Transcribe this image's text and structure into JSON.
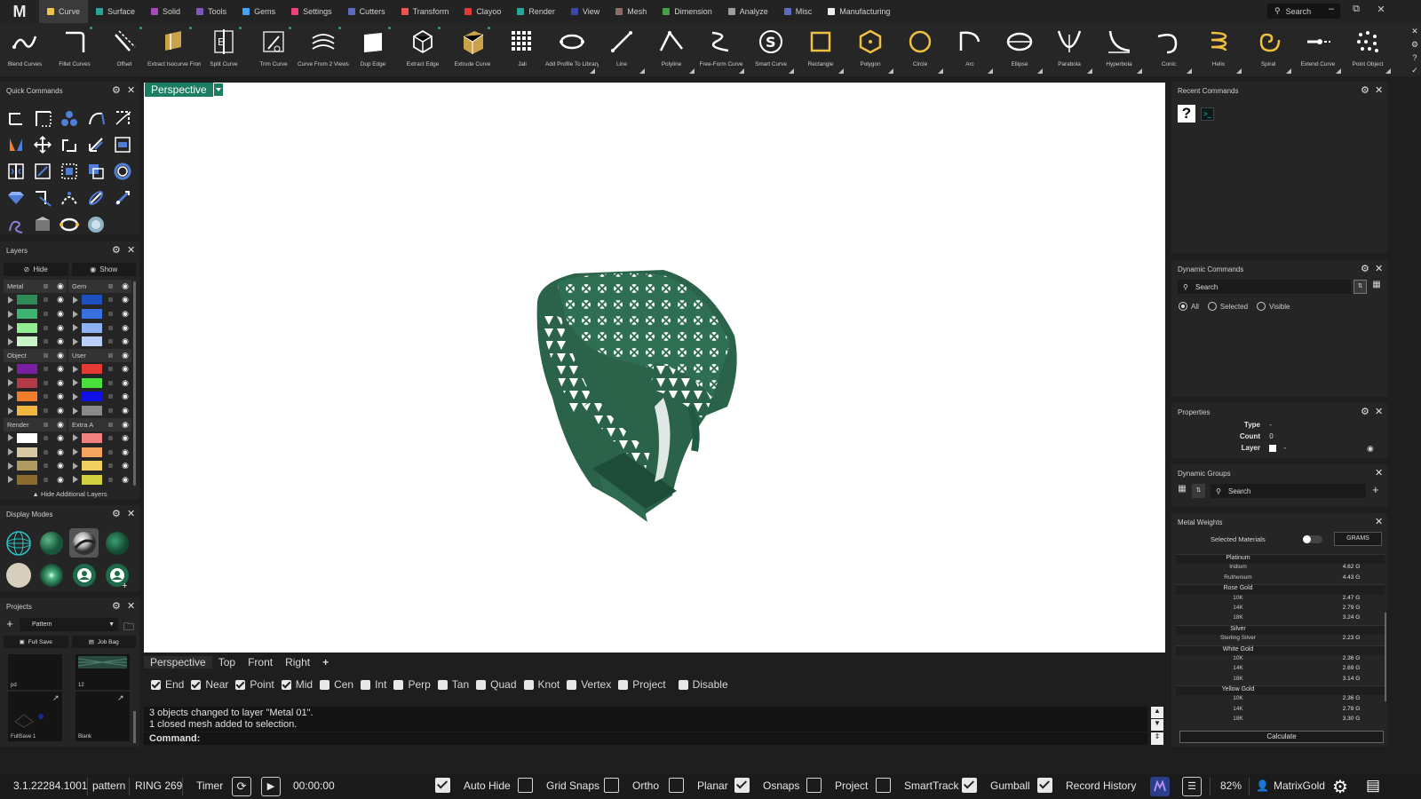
{
  "app": {
    "logo": "M",
    "search_label": "Search"
  },
  "menu": [
    {
      "label": "Curve",
      "color": "#f2c14e",
      "active": true
    },
    {
      "label": "Surface",
      "color": "#26a69a"
    },
    {
      "label": "Solid",
      "color": "#ab47bc"
    },
    {
      "label": "Tools",
      "color": "#7e57c2"
    },
    {
      "label": "Gems",
      "color": "#42a5f5"
    },
    {
      "label": "Settings",
      "color": "#ec407a"
    },
    {
      "label": "Cutters",
      "color": "#5c6bc0"
    },
    {
      "label": "Transform",
      "color": "#ef5350"
    },
    {
      "label": "Clayoo",
      "color": "#e53935"
    },
    {
      "label": "Render",
      "color": "#26a69a"
    },
    {
      "label": "View",
      "color": "#3949ab"
    },
    {
      "label": "Mesh",
      "color": "#8d6e63"
    },
    {
      "label": "Dimension",
      "color": "#43a047"
    },
    {
      "label": "Analyze",
      "color": "#9e9e9e"
    },
    {
      "label": "Misc",
      "color": "#5c6bc0"
    },
    {
      "label": "Manufacturing",
      "color": "#eeeeee"
    }
  ],
  "toolbar": [
    {
      "label": "Blend Curves",
      "icon": "blend-curves-icon"
    },
    {
      "label": "Fillet Curves",
      "icon": "fillet-curves-icon"
    },
    {
      "label": "Offset",
      "icon": "offset-icon"
    },
    {
      "label": "Extract Isocurve From...",
      "icon": "extract-isocurve-icon"
    },
    {
      "label": "Split Curve",
      "icon": "split-curve-icon"
    },
    {
      "label": "Trim Curve",
      "icon": "trim-curve-icon"
    },
    {
      "label": "Curve From 2 Views",
      "icon": "curve-from-2-views-icon"
    },
    {
      "label": "Dup Edge",
      "icon": "dup-edge-icon"
    },
    {
      "label": "Extract Edge",
      "icon": "extract-edge-icon"
    },
    {
      "label": "Extrude Curve",
      "icon": "extrude-curve-icon"
    },
    {
      "label": "Jali",
      "icon": "jali-icon"
    },
    {
      "label": "Add Profile To Library",
      "icon": "add-profile-icon"
    },
    {
      "label": "Line",
      "icon": "line-icon"
    },
    {
      "label": "Polyline",
      "icon": "polyline-icon"
    },
    {
      "label": "Free-Form Curve",
      "icon": "free-form-curve-icon"
    },
    {
      "label": "Smart Curve",
      "icon": "smart-curve-icon"
    },
    {
      "label": "Rectangle",
      "icon": "rectangle-icon"
    },
    {
      "label": "Polygon",
      "icon": "polygon-icon"
    },
    {
      "label": "Circle",
      "icon": "circle-icon"
    },
    {
      "label": "Arc",
      "icon": "arc-icon"
    },
    {
      "label": "Ellipse",
      "icon": "ellipse-icon"
    },
    {
      "label": "Parabola",
      "icon": "parabola-icon"
    },
    {
      "label": "Hyperbola",
      "icon": "hyperbola-icon"
    },
    {
      "label": "Conic",
      "icon": "conic-icon"
    },
    {
      "label": "Helix",
      "icon": "helix-icon"
    },
    {
      "label": "Spiral",
      "icon": "spiral-icon"
    },
    {
      "label": "Extend Curve",
      "icon": "extend-curve-icon"
    },
    {
      "label": "Point Object",
      "icon": "point-object-icon"
    }
  ],
  "panels": {
    "quick_commands": {
      "title": "Quick Commands"
    },
    "layers": {
      "title": "Layers",
      "hide_label": "Hide",
      "show_label": "Show",
      "footer": "Hide Additional Layers",
      "left": [
        {
          "group": "Metal",
          "colors": [
            "#2e8b57",
            "#3cb371",
            "#90ee90",
            "#c8f5c8"
          ]
        },
        {
          "group": "Object",
          "colors": [
            "#7b1fa2",
            "#b23a48",
            "#ef7d2c",
            "#f2b640"
          ]
        },
        {
          "group": "Render",
          "colors": [
            "#ffffff",
            "#d8c9a3",
            "#b09a60",
            "#8b6b2e"
          ]
        }
      ],
      "right": [
        {
          "group": "Gem",
          "colors": [
            "#1e4fbf",
            "#3a6fe0",
            "#8fb2f5",
            "#b9cff8"
          ]
        },
        {
          "group": "User",
          "colors": [
            "#e53935",
            "#4cdf3c",
            "#1010e8",
            "#8a8a8a"
          ]
        },
        {
          "group": "Extra A",
          "colors": [
            "#f08080",
            "#f4a460",
            "#f0d060",
            "#d0d040"
          ]
        }
      ]
    },
    "display_modes": {
      "title": "Display Modes"
    },
    "projects": {
      "title": "Projects",
      "selected": "Pattern",
      "full_save": "Full Save",
      "job_bag": "Job Bag",
      "thumbs": [
        "pd",
        "12",
        "FullSave 1",
        "Blank"
      ]
    },
    "recent_commands": {
      "title": "Recent Commands"
    },
    "dynamic_commands": {
      "title": "Dynamic Commands",
      "search": "Search",
      "filters": [
        "All",
        "Selected",
        "Visible"
      ]
    },
    "properties": {
      "title": "Properties",
      "rows": [
        {
          "label": "Type",
          "value": "-"
        },
        {
          "label": "Count",
          "value": "0"
        },
        {
          "label": "Layer",
          "value": "-"
        }
      ]
    },
    "dynamic_groups": {
      "title": "Dynamic Groups",
      "search": "Search"
    },
    "metal_weights": {
      "title": "Metal Weights",
      "selected_materials": "Selected Materials",
      "unit": "GRAMS",
      "calculate": "Calculate",
      "groups": [
        {
          "name": "Platinum",
          "rows": [
            {
              "name": "Iridium",
              "value": "4.62 G"
            },
            {
              "name": "Ruthenium",
              "value": "4.43 G"
            }
          ]
        },
        {
          "name": "Rose Gold",
          "rows": [
            {
              "name": "10K",
              "value": "2.47 G"
            },
            {
              "name": "14K",
              "value": "2.79 G"
            },
            {
              "name": "18K",
              "value": "3.24 G"
            }
          ]
        },
        {
          "name": "Silver",
          "rows": [
            {
              "name": "Sterling Silver",
              "value": "2.23 G"
            }
          ]
        },
        {
          "name": "White Gold",
          "rows": [
            {
              "name": "10K",
              "value": "2.36 G"
            },
            {
              "name": "14K",
              "value": "2.69 G"
            },
            {
              "name": "18K",
              "value": "3.14 G"
            }
          ]
        },
        {
          "name": "Yellow Gold",
          "rows": [
            {
              "name": "10K",
              "value": "2.36 G"
            },
            {
              "name": "14K",
              "value": "2.78 G"
            },
            {
              "name": "18K",
              "value": "3.30 G"
            }
          ]
        }
      ]
    }
  },
  "viewport": {
    "active_tab": "Perspective",
    "view_tabs": [
      "Perspective",
      "Top",
      "Front",
      "Right"
    ],
    "add_tab": "+"
  },
  "osnaps": [
    {
      "label": "End",
      "on": true
    },
    {
      "label": "Near",
      "on": true
    },
    {
      "label": "Point",
      "on": true
    },
    {
      "label": "Mid",
      "on": true
    },
    {
      "label": "Cen",
      "on": false
    },
    {
      "label": "Int",
      "on": false
    },
    {
      "label": "Perp",
      "on": false
    },
    {
      "label": "Tan",
      "on": false
    },
    {
      "label": "Quad",
      "on": false
    },
    {
      "label": "Knot",
      "on": false
    },
    {
      "label": "Vertex",
      "on": false
    },
    {
      "label": "Project",
      "on": false
    },
    {
      "label": "Disable",
      "on": false
    }
  ],
  "command": {
    "history": [
      "3 objects changed to layer \"Metal 01\".",
      "1 closed mesh added to selection."
    ],
    "prompt": "Command:"
  },
  "status": {
    "version": "3.1.22284.1001",
    "project": "pattern",
    "file": "RING 269",
    "timer_label": "Timer",
    "time": "00:00:00",
    "toggles": [
      {
        "label": "Auto Hide",
        "on": true
      },
      {
        "label": "Grid Snaps",
        "on": false
      },
      {
        "label": "Ortho",
        "on": false
      },
      {
        "label": "Planar",
        "on": false
      },
      {
        "label": "Osnaps",
        "on": true
      },
      {
        "label": "Project",
        "on": false
      },
      {
        "label": "SmartTrack",
        "on": false
      },
      {
        "label": "Gumball",
        "on": true
      },
      {
        "label": "Record History",
        "on": true
      }
    ],
    "zoom": "82%",
    "user": "MatrixGold"
  }
}
